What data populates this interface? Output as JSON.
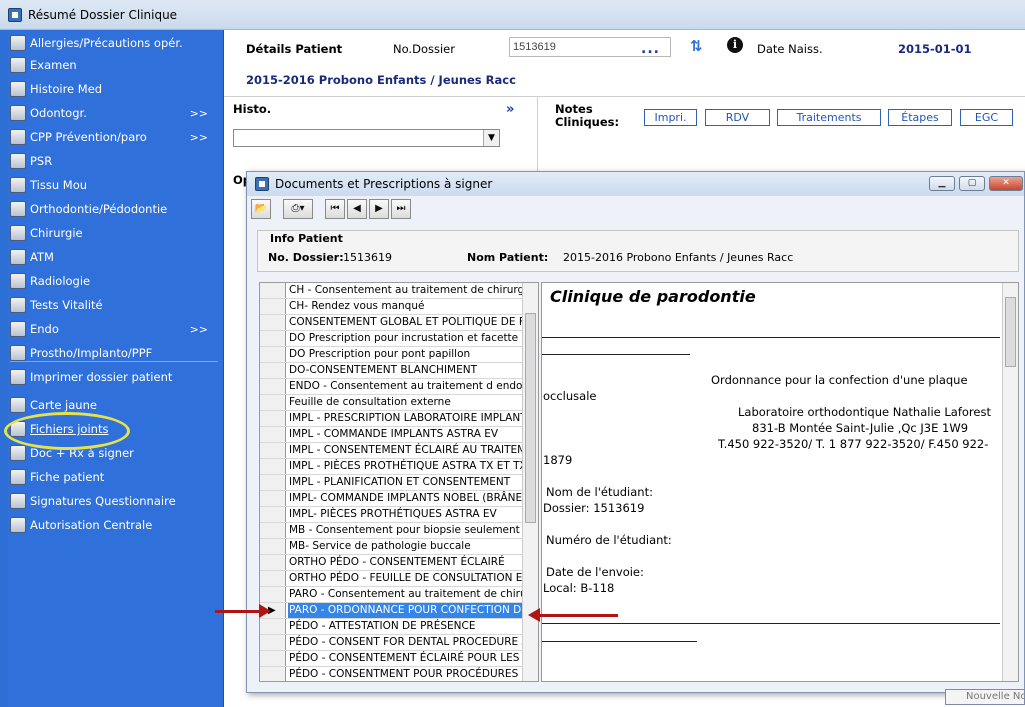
{
  "window": {
    "title": "Résumé Dossier Clinique"
  },
  "sidebar": {
    "items": [
      {
        "label": "Allergies/Précautions opér.",
        "icon": "plus-icon",
        "arrow": ""
      },
      {
        "label": "Examen",
        "icon": "exam-icon",
        "arrow": ""
      },
      {
        "label": "Histoire Med",
        "icon": "history-icon",
        "arrow": ""
      },
      {
        "label": "Odontogr.",
        "icon": "odontogram-icon",
        "arrow": ">>"
      },
      {
        "label": "CPP Prévention/paro",
        "icon": "tooth-icon",
        "arrow": ">>"
      },
      {
        "label": "PSR",
        "icon": "tooth-icon",
        "arrow": ""
      },
      {
        "label": "Tissu Mou",
        "icon": "tissue-icon",
        "arrow": ""
      },
      {
        "label": "Orthodontie/Pédodontie",
        "icon": "orthodontics-icon",
        "arrow": ""
      },
      {
        "label": "Chirurgie",
        "icon": "surgery-icon",
        "arrow": ""
      },
      {
        "label": "ATM",
        "icon": "atm-icon",
        "arrow": ""
      },
      {
        "label": "Radiologie",
        "icon": "xray-icon",
        "arrow": ""
      },
      {
        "label": "Tests Vitalité",
        "icon": "vitality-icon",
        "arrow": ""
      },
      {
        "label": "Endo",
        "icon": "endo-icon",
        "arrow": ">>"
      },
      {
        "label": "Prostho/Implanto/PPF",
        "icon": "prostho-icon",
        "arrow": ""
      },
      {
        "label": "Imprimer dossier patient",
        "icon": "printer-icon",
        "arrow": ""
      },
      {
        "label": "Carte jaune",
        "icon": "card-icon",
        "arrow": ""
      },
      {
        "label": "Fichiers joints",
        "icon": "paperclip-icon",
        "arrow": ""
      },
      {
        "label": "Doc + Rx à signer",
        "icon": "sign-icon",
        "arrow": ""
      },
      {
        "label": "Fiche patient",
        "icon": "person-icon",
        "arrow": ""
      },
      {
        "label": "Signatures Questionnaire",
        "icon": "signature-icon",
        "arrow": ""
      },
      {
        "label": "Autorisation Centrale",
        "icon": "authorization-icon",
        "arrow": ""
      }
    ]
  },
  "header": {
    "details_label": "Détails Patient",
    "dossier_label": "No.Dossier",
    "dossier_value": "1513619",
    "dots": "...",
    "birth_label": "Date Naiss.",
    "birth_value": "2015-01-01",
    "patient_name": "2015-2016 Probono Enfants / Jeunes Racc"
  },
  "histo": {
    "label": "Histo.",
    "more": "»",
    "selected": ""
  },
  "notes": {
    "label_line1": "Notes",
    "label_line2": "Cliniques:",
    "buttons": [
      "Impri.",
      "RDV",
      "Traitements",
      "Étapes",
      "EGC"
    ]
  },
  "partial_label": "Op",
  "dialog": {
    "title": "Documents et Prescriptions à signer",
    "info_legend": "Info Patient",
    "dossier_label": "No. Dossier:",
    "dossier_value": "1513619",
    "name_label": "Nom Patient:",
    "name_value": "2015-2016 Probono Enfants / Jeunes Racc",
    "documents": [
      "CH - Consentement  au traitement de chirurgie b",
      "CH- Rendez vous manqué",
      "CONSENTEMENT GLOBAL ET POLITIQUE DE FAC",
      "DO Prescription pour incrustation et facette",
      "DO Prescription pour pont papillon",
      "DO-CONSENTEMENT BLANCHIMENT",
      "ENDO - Consentement au traitement d endodont",
      "Feuille de consultation externe",
      "IMPL -  PRESCRIPTION LABORATOIRE IMPLANTO",
      "IMPL - COMMANDE IMPLANTS  ASTRA EV",
      "IMPL - CONSENTEMENT ÉCLAIRÉ AU TRAITEMEN",
      "IMPL - PIÈCES PROTHÉTIQUE ASTRA TX ET TX P",
      "IMPL - PLANIFICATION ET CONSENTEMENT",
      "IMPL- COMMANDE IMPLANTS NOBEL (BRÂNEMAR",
      "IMPL- PIÈCES PROTHÉTIQUES ASTRA EV",
      "MB - Consentement pour biopsie seulement",
      "MB- Service de pathologie buccale",
      "ORTHO PÉDO - CONSENTEMENT ÉCLAIRÉ",
      "ORTHO PÉDO - FEUILLE DE CONSULTATION EXT",
      "PARO - Consentement  au traitement de chirurgi",
      "PARO - ORDONNANCE POUR CONFECTION DUN",
      "PÉDO - ATTESTATION DE PRÉSENCE",
      "PÉDO - CONSENT FOR DENTAL PROCEDURE AND",
      "PÉDO - CONSENTEMENT ÉCLAIRÉ POUR LES TEC",
      "PÉDO - CONSENTMENT POUR PROCÉDURES DEN"
    ],
    "selected_index": 20,
    "preview": {
      "heading": "Clinique de parodontie",
      "title_line1": "Ordonnance pour la confection d'une plaque",
      "title_line2": "occlusale",
      "lab_name": "Laboratoire orthodontique Nathalie Laforest",
      "lab_address": "831-B Montée Saint-Julie ,Qc J3E 1W9",
      "lab_phone": "T.450 922-3520/ T. 1 877 922-3520/ F.450 922-",
      "lab_phone2": "1879",
      "student_name": "Nom de l'étudiant:",
      "dossier": "Dossier: 1513619",
      "student_number": "Numéro de l'étudiant:",
      "send_date": "Date de l'envoie:",
      "local": "Local: B-118"
    }
  },
  "partial_bottom_button": "Nouvelle Nc",
  "colors": {
    "sidebar": "#2f70da",
    "accent": "#1f57b0",
    "selection": "#3385e8",
    "arrow": "#b01515"
  }
}
